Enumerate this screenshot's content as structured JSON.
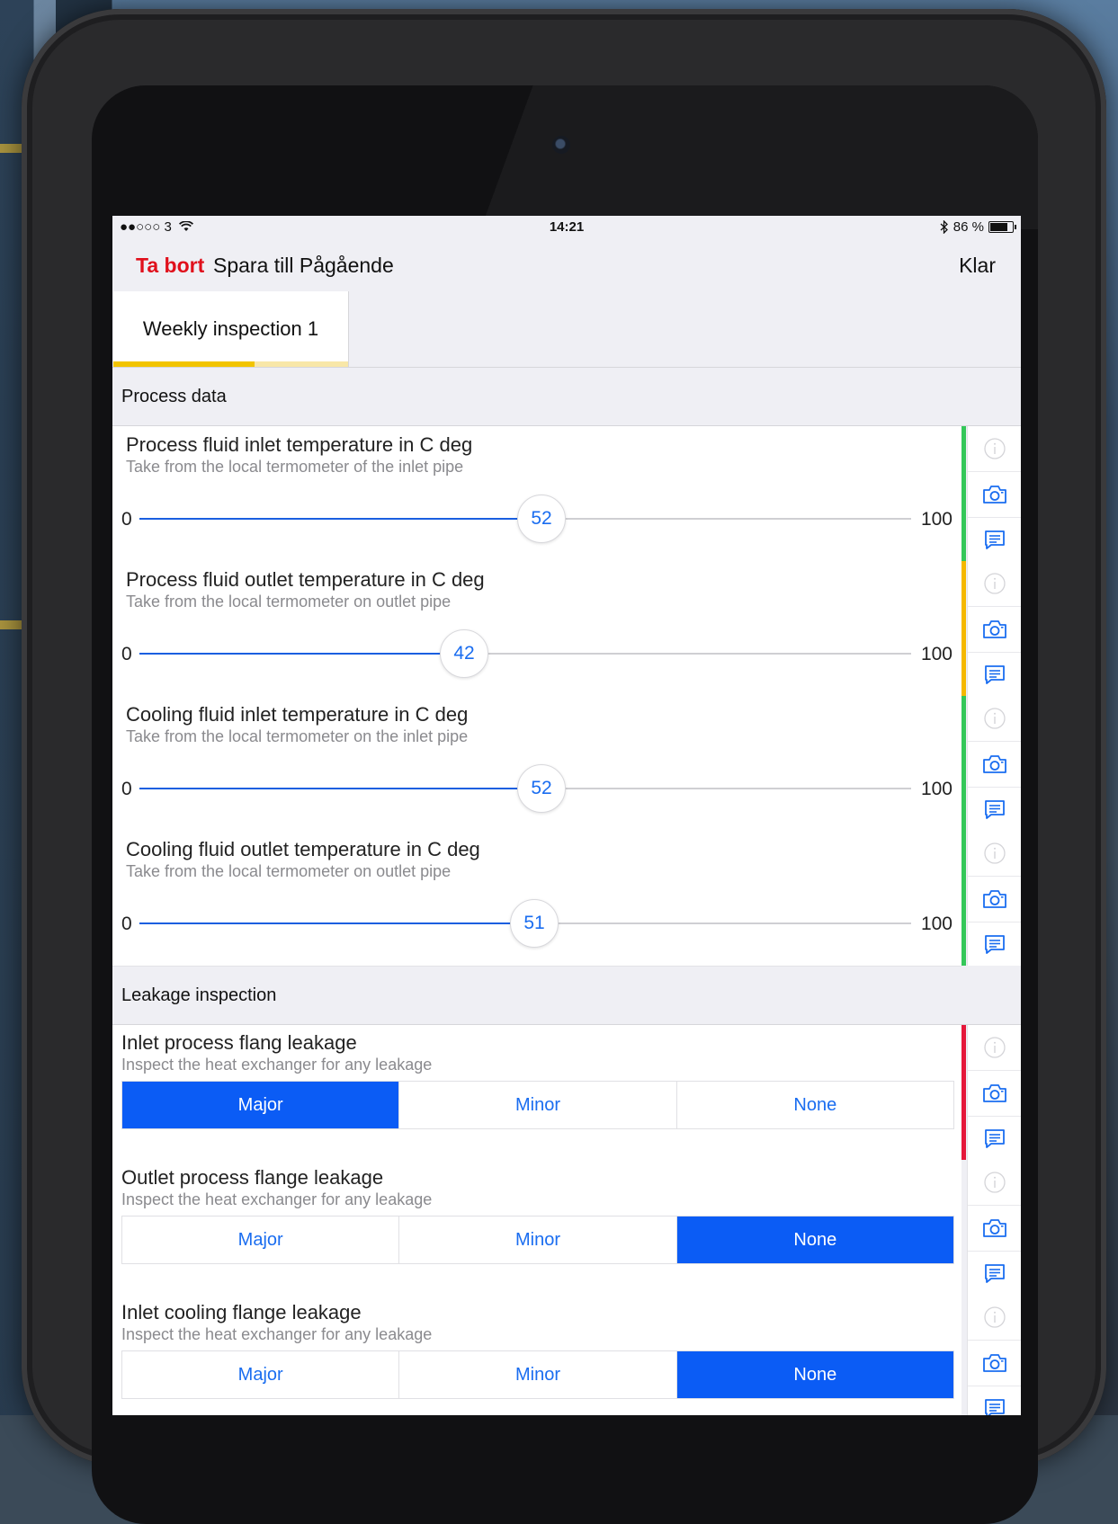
{
  "statusbar": {
    "carrier": "●●○○○ 3",
    "time": "14:21",
    "battery": "86 %",
    "battery_level": 0.86
  },
  "navbar": {
    "delete_label": "Ta bort",
    "save_label": "Spara till Pågående",
    "done_label": "Klar"
  },
  "tabs": [
    {
      "label": "Weekly inspection 1",
      "progress": 0.6
    }
  ],
  "sections": [
    {
      "label": "Process data"
    },
    {
      "label": "Leakage inspection"
    }
  ],
  "sliders": [
    {
      "title": "Process fluid inlet temperature in C deg",
      "subtitle": "Take from the local termometer of the inlet pipe",
      "min": "0",
      "max": "100",
      "value": "52",
      "status_color": "#34c759"
    },
    {
      "title": "Process fluid outlet temperature in C deg",
      "subtitle": "Take from the local termometer on outlet pipe",
      "min": "0",
      "max": "100",
      "value": "42",
      "status_color": "#f5b800"
    },
    {
      "title": "Cooling fluid inlet temperature in C deg",
      "subtitle": "Take from the local termometer on the inlet pipe",
      "min": "0",
      "max": "100",
      "value": "52",
      "status_color": "#34c759"
    },
    {
      "title": "Cooling fluid outlet temperature in C deg",
      "subtitle": "Take from the local termometer on outlet pipe",
      "min": "0",
      "max": "100",
      "value": "51",
      "status_color": "#34c759"
    }
  ],
  "leakage": [
    {
      "title": "Inlet process flang leakage",
      "subtitle": "Inspect the heat exchanger for any leakage",
      "options": [
        "Major",
        "Minor",
        "None"
      ],
      "selected": 0,
      "status_color": "#e5173a"
    },
    {
      "title": "Outlet process flange leakage",
      "subtitle": "Inspect the heat exchanger for any leakage",
      "options": [
        "Major",
        "Minor",
        "None"
      ],
      "selected": 2,
      "status_color": ""
    },
    {
      "title": "Inlet cooling flange leakage",
      "subtitle": "Inspect the heat exchanger for any leakage",
      "options": [
        "Major",
        "Minor",
        "None"
      ],
      "selected": 2,
      "status_color": ""
    }
  ],
  "icons": {
    "info": "info-icon",
    "camera": "camera-icon",
    "comment": "comment-icon",
    "wifi": "wifi-icon",
    "bluetooth": "bluetooth-icon",
    "battery": "battery-icon"
  },
  "colors": {
    "accent": "#1a6df0",
    "selected": "#0b5cf5",
    "delete": "#e0101c",
    "tab_progress": "#f2c400"
  }
}
